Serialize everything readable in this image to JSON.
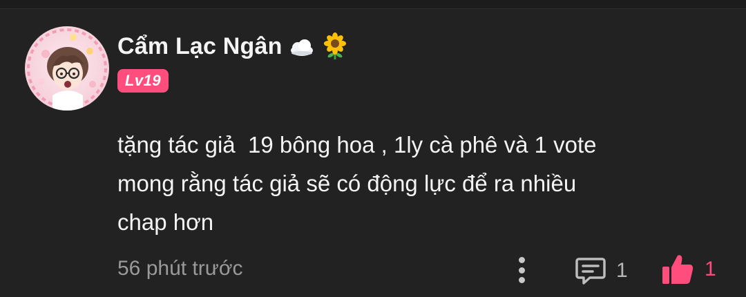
{
  "comment": {
    "username": "Cẩm Lạc Ngân",
    "level": "Lv19",
    "text": "tặng tác giả  19 bông hoa , 1ly cà phê và 1 vote\nmong rằng tác giả sẽ có động lực để ra nhiều\nchap hơn",
    "time": "56 phút trước",
    "reply_count": "1",
    "like_count": "1"
  },
  "icons": {
    "avatar": "avatar",
    "cloud": "cloud-emoji",
    "sunflower": "sunflower-emoji",
    "more": "more-vertical-icon",
    "reply": "comment-bubble-icon",
    "like": "thumbs-up-icon"
  },
  "colors": {
    "background": "#222222",
    "accent": "#ff4d7d",
    "muted_text": "#9a9a9a",
    "primary_text": "#f4f4f4"
  }
}
